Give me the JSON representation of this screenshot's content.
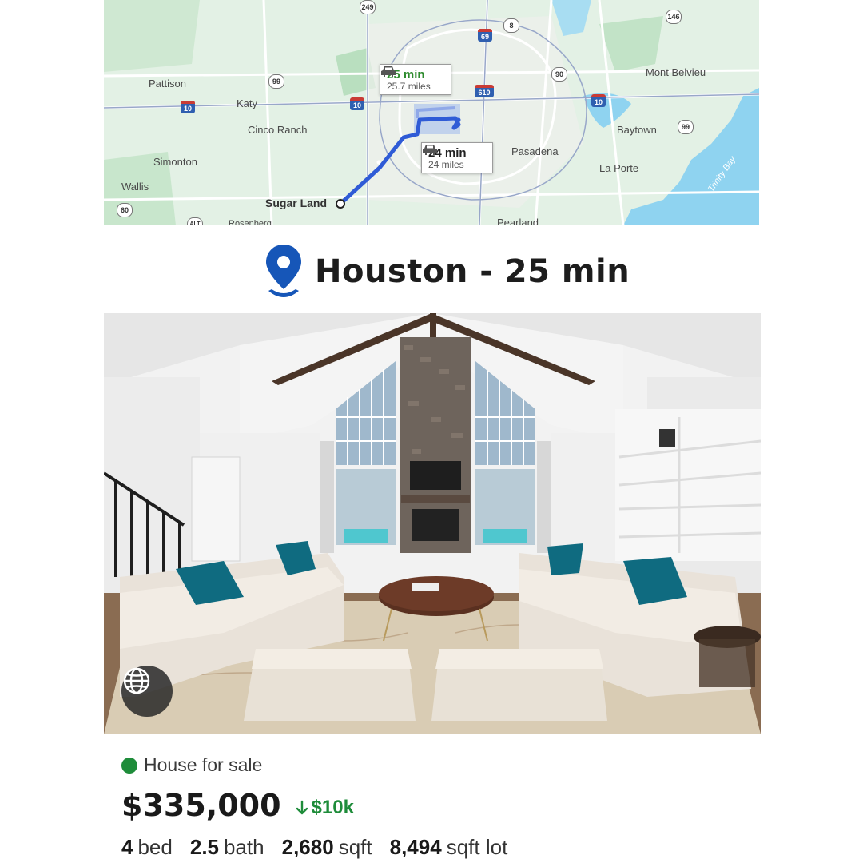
{
  "map": {
    "places": {
      "pattison": "Pattison",
      "katy": "Katy",
      "cinco_ranch": "Cinco Ranch",
      "simonton": "Simonton",
      "wallis": "Wallis",
      "sugar_land": "Sugar Land",
      "mont_belvieu": "Mont Belvieu",
      "baytown": "Baytown",
      "pasadena": "Pasadena",
      "la_porte": "La Porte",
      "trinity_bay": "Trinity Bay",
      "pearland": "Pearland",
      "rosenberg": "Rosenberg"
    },
    "shields": {
      "s249": "249",
      "s69": "69",
      "s8": "8",
      "s146": "146",
      "s99a": "99",
      "s90": "90",
      "s10a": "10",
      "s10b": "10",
      "s10c": "10",
      "s610": "610",
      "s99b": "99",
      "s60": "60",
      "s_alt": "ALT"
    },
    "route_primary": {
      "time": "25 min",
      "distance": "25.7 miles",
      "color": "#2e8b2e"
    },
    "route_alt": {
      "time": "24 min",
      "distance": "24 miles"
    },
    "route_color": "#2f5bd6"
  },
  "heading": {
    "text": "Houston - 25 min",
    "icon": "location-pin-icon",
    "icon_color": "#1656b8"
  },
  "photo": {
    "alt_icon": "globe-icon"
  },
  "listing": {
    "status": "House for sale",
    "status_color": "#1e8c3a",
    "price": "$335,000",
    "price_drop": "$10k",
    "facts": [
      {
        "value": "4",
        "unit": "bed"
      },
      {
        "value": "2.5",
        "unit": "bath"
      },
      {
        "value": "2,680",
        "unit": "sqft"
      },
      {
        "value": "8,494",
        "unit": "sqft lot"
      }
    ]
  }
}
